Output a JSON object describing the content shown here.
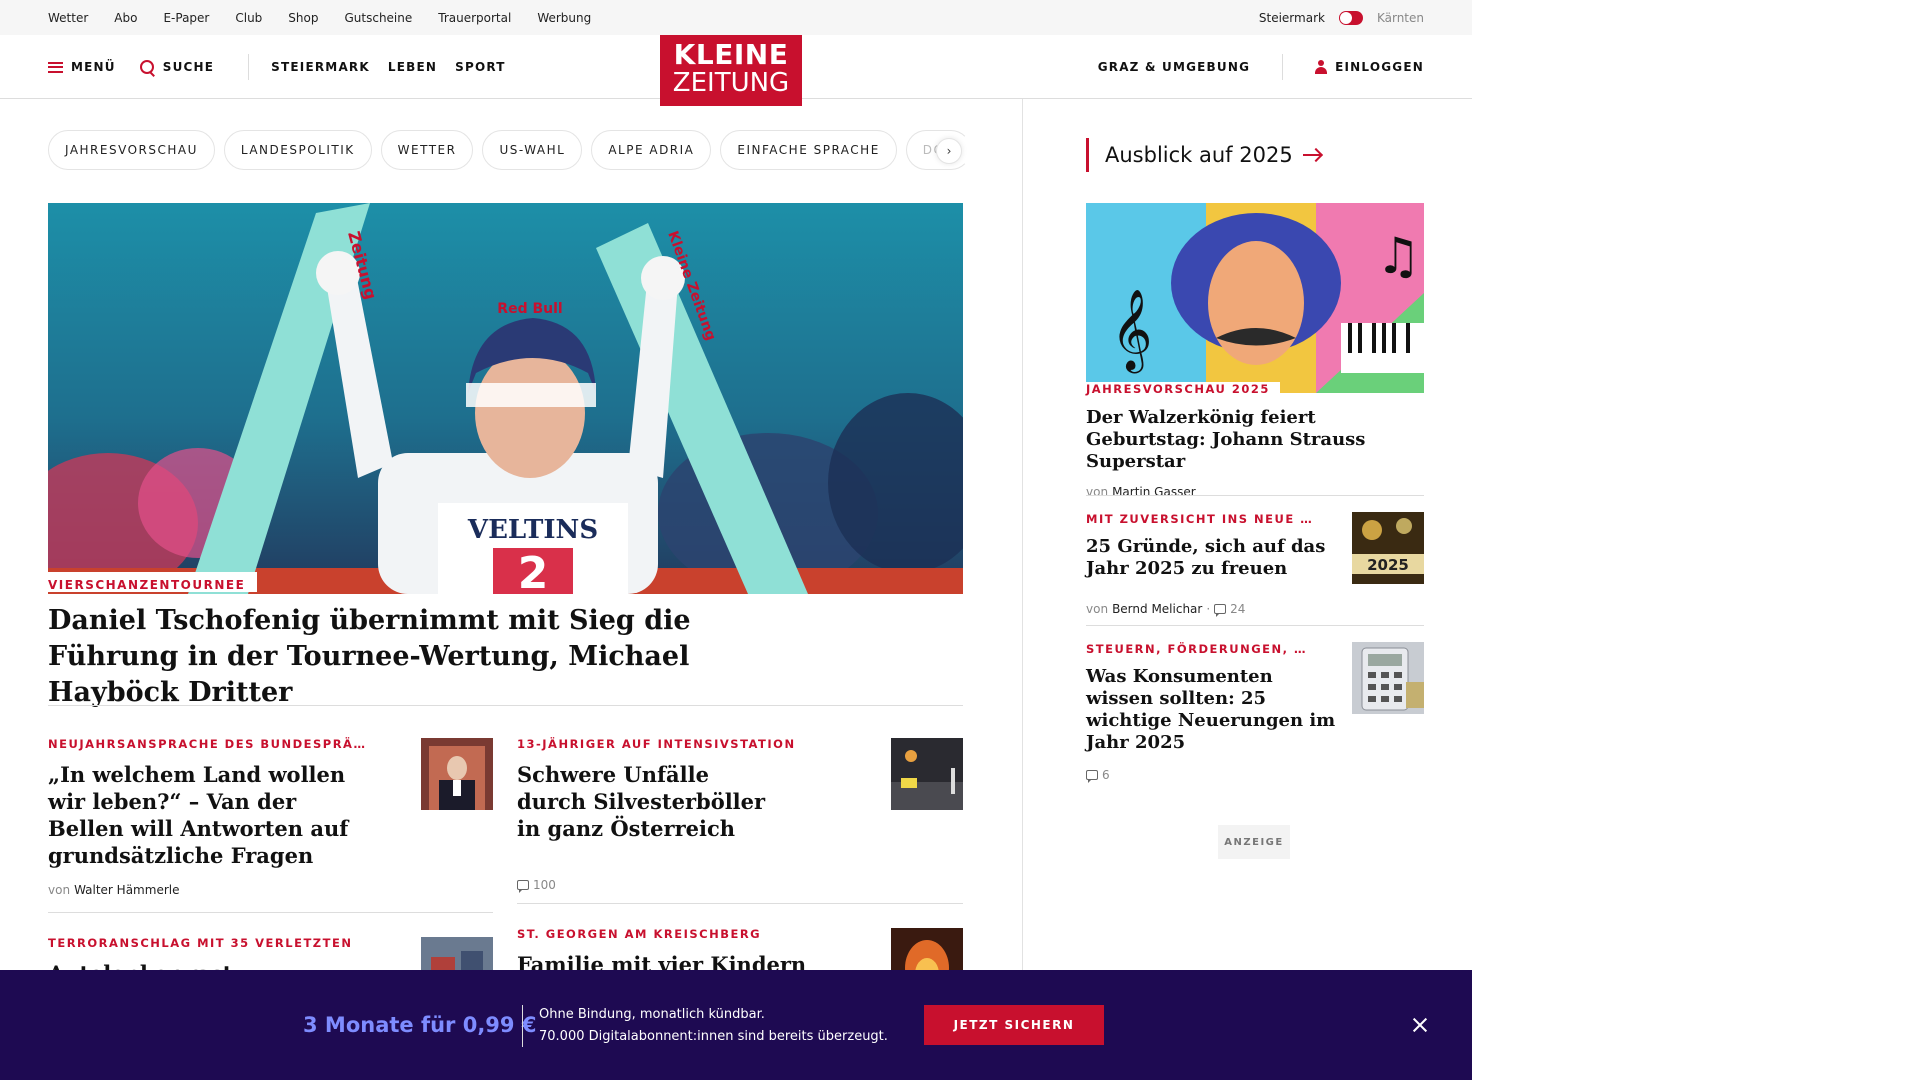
{
  "topbar": {
    "links": [
      "Wetter",
      "Abo",
      "E-Paper",
      "Club",
      "Shop",
      "Gutscheine",
      "Trauerportal",
      "Werbung"
    ],
    "region_left": "Steiermark",
    "region_right": "Kärnten"
  },
  "header": {
    "menu_label": "MENÜ",
    "search_label": "SUCHE",
    "nav": [
      "STEIERMARK",
      "LEBEN",
      "SPORT"
    ],
    "logo_line1": "KLEINE",
    "logo_line2": "ZEITUNG",
    "region_link": "GRAZ & UMGEBUNG",
    "login_label": "EINLOGGEN"
  },
  "chips": [
    "JAHRESVORSCHAU",
    "LANDESPOLITIK",
    "WETTER",
    "US-WAHL",
    "ALPE ADRIA",
    "EINFACHE SPRACHE",
    "DOS"
  ],
  "hero": {
    "tag": "VIERSCHANZENTOURNEE",
    "title": "Daniel Tschofenig übernimmt mit Sieg die Führung in der Tournee-Wertung, Michael Hayböck Dritter",
    "image_text": {
      "helmet": "Red Bull",
      "bib": "VELTINS",
      "bib_number": "2",
      "ski_left": "Zeitung",
      "ski_right": "Kleine Zeitung"
    }
  },
  "articles": [
    {
      "tag": "NEUJAHRSANSPRACHE DES BUNDESPRÄ…",
      "title": "„In welchem Land wollen wir leben?“ – Van der Bellen will Antworten auf grundsätzliche Fragen",
      "byline_prefix": "von",
      "author": "Walter Hämmerle"
    },
    {
      "tag": "13-JÄHRIGER AUF INTENSIVSTATION",
      "title": "Schwere Unfälle durch Silvesterböller in ganz Österreich",
      "comments": "100"
    },
    {
      "tag": "TERRORANSCHLAG MIT 35 VERLETZTEN",
      "title": "Autolenker rast absichtlich"
    },
    {
      "tag": "ST. GEORGEN AM KREISCHBERG",
      "title": "Familie mit vier Kindern"
    }
  ],
  "sidebar": {
    "heading": "Ausblick auf 2025",
    "items": [
      {
        "tag": "JAHRESVORSCHAU 2025",
        "title": "Der Walzerkönig feiert Geburtstag: Johann Strauss Superstar",
        "byline_prefix": "von",
        "author": "Martin Gasser"
      },
      {
        "tag": "MIT ZUVERSICHT INS NEUE …",
        "title": "25 Gründe, sich auf das Jahr 2025 zu freuen",
        "byline_prefix": "von",
        "author": "Bernd Melichar",
        "comments": "24",
        "thumb_text": "2025"
      },
      {
        "tag": "STEUERN, FÖRDERUNGEN, …",
        "title": "Was Konsumenten wissen sollten: 25 wichtige Neuerungen im Jahr 2025",
        "comments": "6"
      }
    ],
    "ad_label": "ANZEIGE"
  },
  "banner": {
    "offer": "3 Monate für 0,99 €",
    "line1": "Ohne Bindung, monatlich kündbar.",
    "line2": "70.000 Digitalabonnent:innen sind bereits überzeugt.",
    "cta": "JETZT SICHERN"
  },
  "colors": {
    "brand_red": "#c8102e",
    "banner_bg": "#1e0a52",
    "offer_text": "#7e8cff"
  }
}
